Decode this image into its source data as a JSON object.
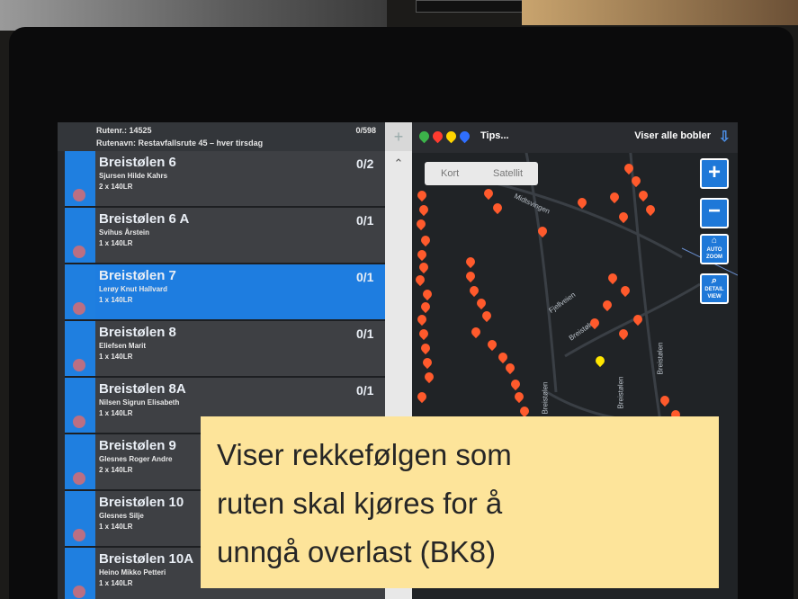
{
  "route": {
    "number_label": "Rutenr.: 14525",
    "name_label": "Rutenavn: Restavfallsrute 45 – hver tirsdag",
    "count": "0/598"
  },
  "stops": [
    {
      "title": "Breistølen 6",
      "owner": "Sjursen Hilde Kahrs",
      "bins": "2 x 140LR",
      "count": "0/2"
    },
    {
      "title": "Breistølen 6 A",
      "owner": "Svihus Årstein",
      "bins": "1 x 140LR",
      "count": "0/1"
    },
    {
      "title": "Breistølen 7",
      "owner": "Lerøy Knut Hallvard",
      "bins": "1 x 140LR",
      "count": "0/1",
      "selected": true
    },
    {
      "title": "Breistølen 8",
      "owner": "Eliefsen Marit",
      "bins": "1 x 140LR",
      "count": "0/1"
    },
    {
      "title": "Breistølen 8A",
      "owner": "Nilsen Sigrun Elisabeth",
      "bins": "1 x 140LR",
      "count": "0/1"
    },
    {
      "title": "Breistølen 9",
      "owner": "Glesnes Roger Andre",
      "bins": "2 x 140LR",
      "count": ""
    },
    {
      "title": "Breistølen 10",
      "owner": "Glesnes Silje",
      "bins": "1 x 140LR",
      "count": ""
    },
    {
      "title": "Breistølen 10A",
      "owner": "Heino Mikko Petteri",
      "bins": "1 x 140LR",
      "count": ""
    }
  ],
  "map": {
    "tips_label": "Tips...",
    "bubbles_label": "Viser alle bobler",
    "kort_label": "Kort",
    "satellite_label": "Satellit",
    "auto_zoom_label": "AUTO ZOOM",
    "detail_view_label": "DETAIL VIEW",
    "roads": [
      "Midtsvingen",
      "Fjellveien",
      "Breistølen",
      "Breistølen",
      "Breistølen",
      "Breistølen"
    ],
    "pin_colors": [
      "#3cb34a",
      "#ff3b2f",
      "#ffd400",
      "#2f6fff"
    ]
  },
  "note": {
    "line1": "Viser rekkefølgen som",
    "line2": "ruten skal kjøres for å",
    "line3": "unngå overlast (BK8)"
  }
}
